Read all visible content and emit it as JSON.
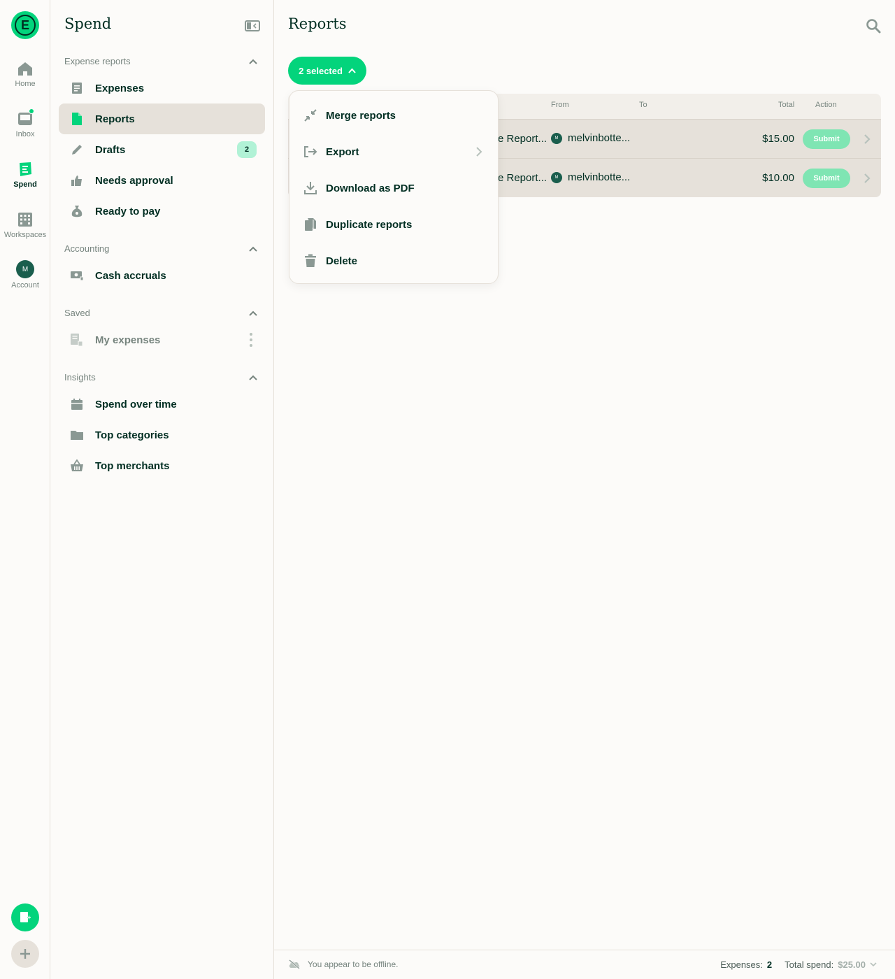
{
  "rail": {
    "home": "Home",
    "inbox": "Inbox",
    "spend": "Spend",
    "workspaces": "Workspaces",
    "account": "Account",
    "avatar_initial": "M"
  },
  "sidebar": {
    "title": "Spend",
    "sections": {
      "expense_reports": "Expense reports",
      "accounting": "Accounting",
      "saved": "Saved",
      "insights": "Insights"
    },
    "items": {
      "expenses": "Expenses",
      "reports": "Reports",
      "drafts": "Drafts",
      "drafts_count": "2",
      "needs_approval": "Needs approval",
      "ready_to_pay": "Ready to pay",
      "cash_accruals": "Cash accruals",
      "my_expenses": "My expenses",
      "spend_over_time": "Spend over time",
      "top_categories": "Top categories",
      "top_merchants": "Top merchants"
    }
  },
  "main": {
    "title": "Reports",
    "selected_label": "2 selected",
    "columns": {
      "from": "From",
      "to": "To",
      "total": "Total",
      "action": "Action"
    },
    "rows": [
      {
        "title": "e Report...",
        "from_initial": "M",
        "from": "melvinbotte...",
        "total": "$15.00",
        "action": "Submit"
      },
      {
        "title": "e Report...",
        "from_initial": "M",
        "from": "melvinbotte...",
        "total": "$10.00",
        "action": "Submit"
      }
    ]
  },
  "menu": {
    "merge": "Merge reports",
    "export": "Export",
    "download": "Download as PDF",
    "duplicate": "Duplicate reports",
    "delete": "Delete"
  },
  "footer": {
    "offline": "You appear to be offline.",
    "expenses_label": "Expenses:",
    "expenses_count": "2",
    "total_label": "Total spend:",
    "total_value": "$25.00"
  },
  "colors": {
    "accent": "#03d47c",
    "text": "#002e22",
    "muted": "#76847e",
    "highlight": "#e6e1da"
  }
}
